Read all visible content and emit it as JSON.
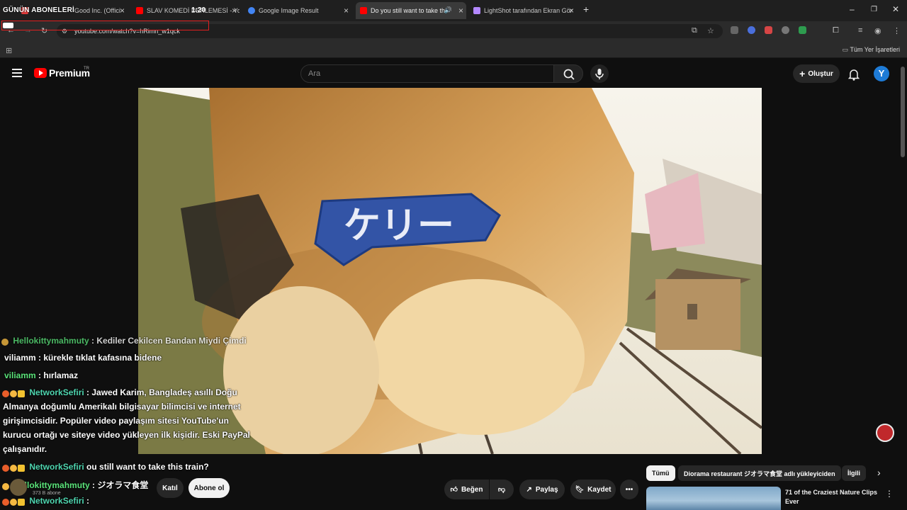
{
  "browser": {
    "tabs": [
      {
        "title": "Good Inc. (Offici",
        "favicon_color": "#e23b3b"
      },
      {
        "title": "SLAV KOMEDİ DERLEMESİ - You",
        "favicon_color": "#ff0000"
      },
      {
        "title": "Google Image Result",
        "favicon_color": "#4285f4"
      },
      {
        "title": "Do you still want to take th",
        "favicon_color": "#ff0000",
        "active": true
      },
      {
        "title": "LightShot tarafından Ekran Gör",
        "favicon_color": "#b388ff"
      }
    ],
    "overlay_title": "GÜNÜN ABONELERİ",
    "overlay_time": "1:20",
    "url": "youtube.com/watch?v=hRimn_w1qck",
    "bookmarks_all": "Tüm Yer İşaretleri"
  },
  "youtube": {
    "logo_text": "Premium",
    "logo_region": "TR",
    "search_placeholder": "Ara",
    "create_label": "Oluştur",
    "avatar_letter": "Y"
  },
  "chat": [
    {
      "user": "Hellokittymahmuty",
      "text": ": Kediler Cekilcen Bandan Miydi Çimdi"
    },
    {
      "user": "viliamm",
      "text": ": kürekle tıklat kafasına bidene"
    },
    {
      "user": "viliamm",
      "text": ": hırlamaz"
    },
    {
      "user": "NetworkSefiri",
      "text": ": Jawed Karim, Bangladeş asıllı Doğu"
    },
    {
      "user": "",
      "text": "Almanya doğumlu Amerikalı bilgisayar bilimcisi ve internet"
    },
    {
      "user": "",
      "text": "girişimcisidir. Popüler video paylaşım sitesi YouTube'un"
    },
    {
      "user": "",
      "text": "kurucu ortağı ve siteye video yükleyen ilk kişidir. Eski PayPal"
    },
    {
      "user": "",
      "text": "çalışanıdır."
    },
    {
      "user": "NetworkSefiri",
      "text": "ou still want to take this train?"
    },
    {
      "user": "Hellokittymahmuty",
      "text": ": ジオラマ食堂"
    },
    {
      "user": "NetworkSefiri",
      "text": ":"
    }
  ],
  "video_below": {
    "subscriber_count": "373 B abone",
    "join_label": "Katıl",
    "subscribe_label": "Abone ol",
    "like_label": "Beğen",
    "share_label": "Paylaş",
    "save_label": "Kaydet"
  },
  "chips": [
    {
      "label": "Tümü",
      "selected": true
    },
    {
      "label": "Diorama restaurant ジオラマ食堂 adlı yükleyiciden"
    },
    {
      "label": "İlgili"
    }
  ],
  "recommendation": {
    "title": "71 of the Craziest Nature Clips Ever"
  },
  "video_sign_text": "ケリー"
}
